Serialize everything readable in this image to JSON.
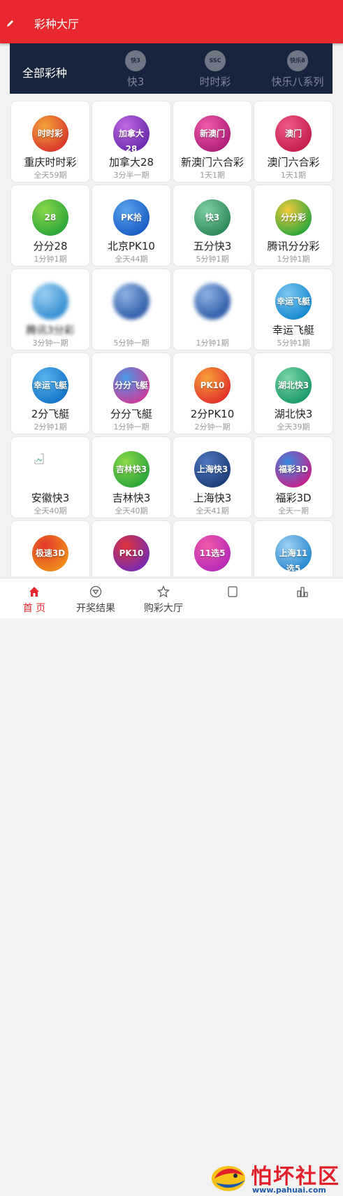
{
  "header": {
    "title": "彩种大厅"
  },
  "tabs": [
    {
      "label": "全部彩种",
      "active": true,
      "logo": ""
    },
    {
      "label": "快3",
      "active": false,
      "logo": "快3"
    },
    {
      "label": "时时彩",
      "active": false,
      "logo": "SSC"
    },
    {
      "label": "快乐八系列",
      "active": false,
      "logo": "快乐8"
    }
  ],
  "games": [
    {
      "name": "重庆时时彩",
      "freq": "全天59期",
      "logo_text": "时时彩",
      "color": "#d93a2b",
      "color2": "#f3a53a"
    },
    {
      "name": "加拿大28",
      "freq": "3分半一期",
      "logo_text": "加拿大28",
      "color": "#6c2bb0",
      "color2": "#c06be0"
    },
    {
      "name": "新澳门六合彩",
      "freq": "1天1期",
      "logo_text": "新澳门",
      "color": "#b0207a",
      "color2": "#f05aa8"
    },
    {
      "name": "澳门六合彩",
      "freq": "1天1期",
      "logo_text": "澳门",
      "color": "#c41f4f",
      "color2": "#ef5a86"
    },
    {
      "name": "分分28",
      "freq": "1分钟1期",
      "logo_text": "28",
      "color": "#2da63a",
      "color2": "#8bd84a"
    },
    {
      "name": "北京PK10",
      "freq": "全天44期",
      "logo_text": "PK拾",
      "color": "#1b5fc4",
      "color2": "#5ba3f0"
    },
    {
      "name": "五分快3",
      "freq": "5分钟1期",
      "logo_text": "快3",
      "color": "#2f8a5a",
      "color2": "#7fcfa0"
    },
    {
      "name": "腾讯分分彩",
      "freq": "1分钟1期",
      "logo_text": "分分彩",
      "color": "#2fa83a",
      "color2": "#f4c93a"
    },
    {
      "name": "腾讯3分彩",
      "freq": "3分钟一期",
      "logo_text": "",
      "color": "#2e8bd0",
      "color2": "#9ed0f2",
      "blurred": true
    },
    {
      "name": "",
      "freq": "5分钟一期",
      "logo_text": "",
      "color": "#2a5aa8",
      "color2": "#8fb4e2",
      "blurred": true
    },
    {
      "name": "",
      "freq": "1分钟1期",
      "logo_text": "",
      "color": "#2a5aa8",
      "color2": "#8fb4e2",
      "blurred": true
    },
    {
      "name": "幸运飞艇",
      "freq": "5分钟1期",
      "logo_text": "幸运飞艇",
      "color": "#1a8ad0",
      "color2": "#7cc8f0"
    },
    {
      "name": "2分飞艇",
      "freq": "2分钟1期",
      "logo_text": "幸运飞艇",
      "color": "#1576c8",
      "color2": "#5ab4ee"
    },
    {
      "name": "分分飞艇",
      "freq": "1分钟一期",
      "logo_text": "分分飞艇",
      "color": "#c83e9e",
      "color2": "#4a9ae6"
    },
    {
      "name": "2分PK10",
      "freq": "2分钟一期",
      "logo_text": "PK10",
      "color": "#e2342a",
      "color2": "#f7a23a"
    },
    {
      "name": "湖北快3",
      "freq": "全天39期",
      "logo_text": "湖北快3",
      "color": "#1d9a6a",
      "color2": "#7ad6a6"
    },
    {
      "name": "安徽快3",
      "freq": "全天40期",
      "logo_text": "",
      "color": "#ffffff",
      "color2": "#ffffff",
      "broken": true
    },
    {
      "name": "吉林快3",
      "freq": "全天40期",
      "logo_text": "吉林快3",
      "color": "#2da63a",
      "color2": "#8bd84a"
    },
    {
      "name": "上海快3",
      "freq": "全天41期",
      "logo_text": "上海快3",
      "color": "#1e3f7a",
      "color2": "#4f78c0"
    },
    {
      "name": "福彩3D",
      "freq": "全天一期",
      "logo_text": "福彩3D",
      "color": "#c0248e",
      "color2": "#3a8ae0"
    },
    {
      "name": "",
      "freq": "",
      "logo_text": "极速3D",
      "color": "#f08a1a",
      "color2": "#e23a2a",
      "partial": true
    },
    {
      "name": "",
      "freq": "",
      "logo_text": "PK10",
      "color": "#7a2bb0",
      "color2": "#e0343a",
      "partial": true
    },
    {
      "name": "",
      "freq": "",
      "logo_text": "11选5",
      "color": "#b82bb8",
      "color2": "#f05aa8",
      "partial": true
    },
    {
      "name": "",
      "freq": "",
      "logo_text": "上海11选5",
      "color": "#2a8ad0",
      "color2": "#9ed0f2",
      "partial": true
    }
  ],
  "tabbar": [
    {
      "label": "首 页",
      "icon": "home-icon",
      "active": true
    },
    {
      "label": "开奖结果",
      "icon": "award-icon",
      "active": false
    },
    {
      "label": "购彩大厅",
      "icon": "star-icon",
      "active": false
    },
    {
      "label": "",
      "icon": "record-icon",
      "active": false
    },
    {
      "label": "",
      "icon": "ranking-icon",
      "active": false
    }
  ],
  "watermark": {
    "title": "怕坏社区",
    "url": "www.pahuai.com"
  },
  "colors": {
    "brand": "#e8272e",
    "tabs_bg": "#17243d"
  }
}
